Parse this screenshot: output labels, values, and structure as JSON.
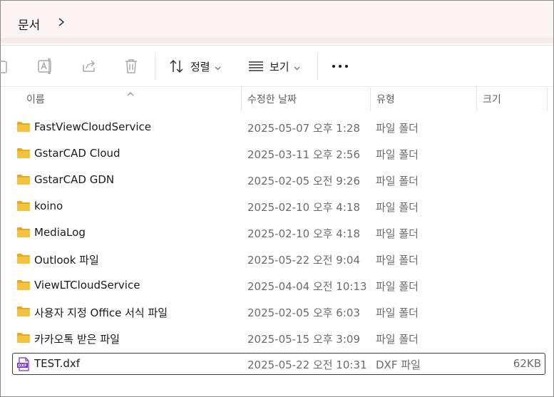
{
  "address": {
    "title": "문서"
  },
  "toolbar": {
    "sort_label": "정렬",
    "view_label": "보기"
  },
  "columns": {
    "name": "이름",
    "date": "수정한 날짜",
    "type": "유형",
    "size": "크기"
  },
  "files": [
    {
      "name": "FastViewCloudService",
      "date": "2025-05-07 오후 1:28",
      "type": "파일 폴더",
      "size": "",
      "icon": "folder-icon"
    },
    {
      "name": "GstarCAD Cloud",
      "date": "2025-03-11 오후 2:56",
      "type": "파일 폴더",
      "size": "",
      "icon": "folder-icon"
    },
    {
      "name": "GstarCAD GDN",
      "date": "2025-02-05 오전 9:26",
      "type": "파일 폴더",
      "size": "",
      "icon": "folder-icon"
    },
    {
      "name": "koino",
      "date": "2025-02-10 오후 4:18",
      "type": "파일 폴더",
      "size": "",
      "icon": "folder-icon"
    },
    {
      "name": "MediaLog",
      "date": "2025-02-10 오후 4:18",
      "type": "파일 폴더",
      "size": "",
      "icon": "folder-icon"
    },
    {
      "name": "Outlook 파일",
      "date": "2025-05-22 오전 9:04",
      "type": "파일 폴더",
      "size": "",
      "icon": "folder-icon"
    },
    {
      "name": "ViewLTCloudService",
      "date": "2025-04-04 오전 10:13",
      "type": "파일 폴더",
      "size": "",
      "icon": "folder-icon"
    },
    {
      "name": "사용자 지정 Office 서식 파일",
      "date": "2025-02-05 오후 6:03",
      "type": "파일 폴더",
      "size": "",
      "icon": "folder-icon"
    },
    {
      "name": "카카오톡 받은 파일",
      "date": "2025-05-15 오후 3:09",
      "type": "파일 폴더",
      "size": "",
      "icon": "folder-icon"
    },
    {
      "name": "TEST.dxf",
      "date": "2025-05-22 오전 10:31",
      "type": "DXF 파일",
      "size": "62KB",
      "icon": "dxf-file-icon",
      "selected": true
    }
  ],
  "colors": {
    "folder": "#f3c23e",
    "folder_dark": "#e6a91f",
    "dxf": "#7b2fc9",
    "address_bg": "#fbf4f2"
  }
}
